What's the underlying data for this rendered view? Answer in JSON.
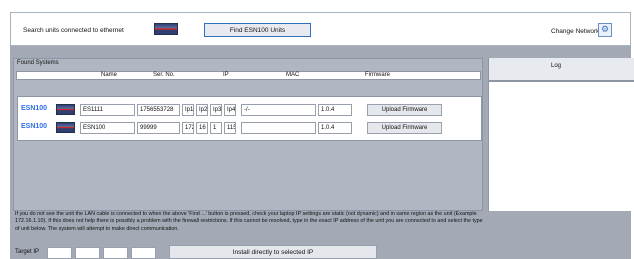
{
  "topbar": {
    "search_label": "Search units connected to ethernet",
    "find_button": "Find ESN100 Units",
    "change_network": "Change Network",
    "network_icon": "network-settings-icon"
  },
  "found": {
    "title": "Found Systems",
    "columns": [
      "Name",
      "Ser. No.",
      "IP",
      "MAC",
      "Firmware"
    ]
  },
  "devices": [
    {
      "model": "ESN100",
      "name": "ES1111",
      "serial": "1756553728",
      "ip": [
        "Ip1",
        "Ip2",
        "Ip3",
        "Ip4"
      ],
      "mac": "-/-",
      "firmware": "1.0.4",
      "upload_label": "Upload Firmware"
    },
    {
      "model": "ESN100",
      "name": "ESN100",
      "serial": "99999",
      "ip": [
        "172",
        "16",
        "1",
        "115"
      ],
      "mac": "",
      "firmware": "1.0.4",
      "upload_label": "Upload Firmware"
    }
  ],
  "log": {
    "title": "Log"
  },
  "info_text": "If you do not see the unit the LAN cable is connected to when the above 'Find ...' button is pressed, check your laptop IP settings are static (not dynamic) and in same region as the unit (Example 172.16.1.10). If this does not help there is possibly a problem with the firewall restrictions. If this cannot be resolved, type in the exact IP address of the unit you are connected to and select the type of unit below. The system will attempt to make direct communication.",
  "target": {
    "label": "Target IP",
    "values": [
      "",
      "",
      "",
      ""
    ],
    "install_button": "Install directly to selected IP"
  },
  "colors": {
    "background_panel": "#a3aab6",
    "accent_blue": "#2d6ee5"
  }
}
